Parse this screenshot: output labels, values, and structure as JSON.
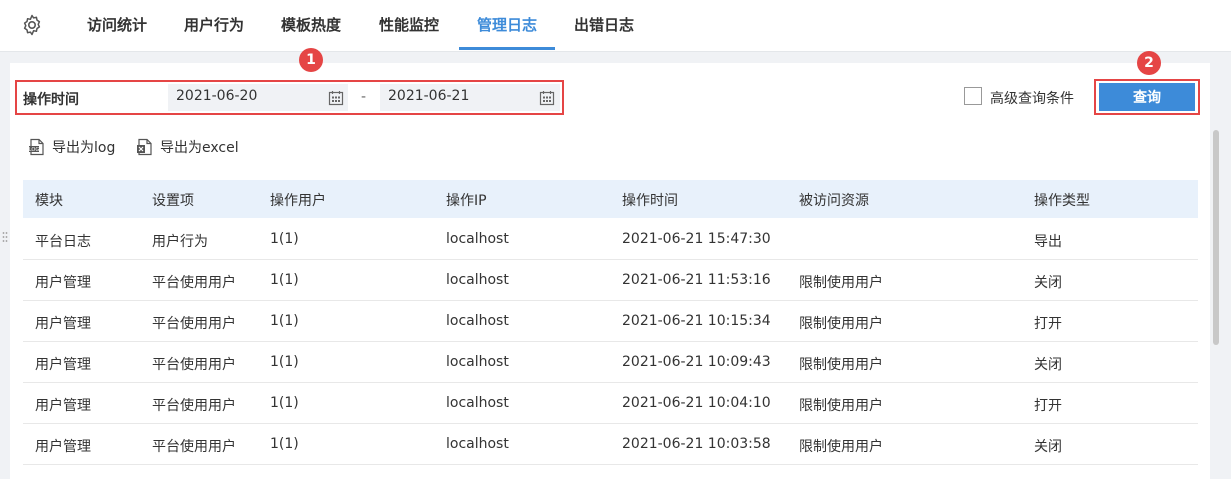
{
  "tabs": [
    {
      "label": "访问统计"
    },
    {
      "label": "用户行为"
    },
    {
      "label": "模板热度"
    },
    {
      "label": "性能监控"
    },
    {
      "label": "管理日志"
    },
    {
      "label": "出错日志"
    }
  ],
  "active_tab": "管理日志",
  "filter": {
    "label": "操作时间",
    "start_date": "2021-06-20",
    "separator": "-",
    "end_date": "2021-06-21"
  },
  "advanced": {
    "label": "高级查询条件",
    "checked": false
  },
  "query_button": "查询",
  "annotations": {
    "badge1": "1",
    "badge2": "2"
  },
  "export": {
    "log_label": "导出为log",
    "excel_label": "导出为excel"
  },
  "table": {
    "columns": [
      "模块",
      "设置项",
      "操作用户",
      "操作IP",
      "操作时间",
      "被访问资源",
      "操作类型"
    ],
    "rows": [
      [
        "平台日志",
        "用户行为",
        "1(1)",
        "localhost",
        "2021-06-21 15:47:30",
        "",
        "导出"
      ],
      [
        "用户管理",
        "平台使用用户",
        "1(1)",
        "localhost",
        "2021-06-21 11:53:16",
        "限制使用用户",
        "关闭"
      ],
      [
        "用户管理",
        "平台使用用户",
        "1(1)",
        "localhost",
        "2021-06-21 10:15:34",
        "限制使用用户",
        "打开"
      ],
      [
        "用户管理",
        "平台使用用户",
        "1(1)",
        "localhost",
        "2021-06-21 10:09:43",
        "限制使用用户",
        "关闭"
      ],
      [
        "用户管理",
        "平台使用用户",
        "1(1)",
        "localhost",
        "2021-06-21 10:04:10",
        "限制使用用户",
        "打开"
      ],
      [
        "用户管理",
        "平台使用用户",
        "1(1)",
        "localhost",
        "2021-06-21 10:03:58",
        "限制使用用户",
        "关闭"
      ]
    ]
  },
  "colors": {
    "accent": "#3d8bd9",
    "highlight": "#e54545",
    "table_header_bg": "#e8f1fb"
  },
  "icons": {
    "settings": "gear-icon",
    "calendar": "calendar-icon",
    "export_log": "log-file-icon",
    "export_excel": "excel-file-icon"
  }
}
